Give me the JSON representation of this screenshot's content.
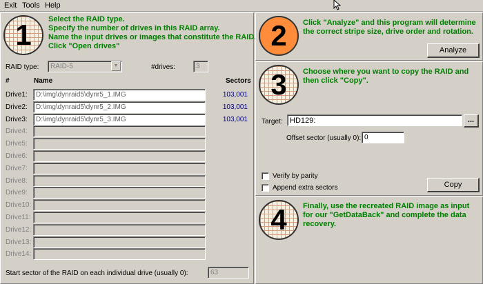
{
  "menu": {
    "exit": "Exit",
    "tools": "Tools",
    "help": "Help"
  },
  "step1": {
    "number": "1",
    "lines": [
      "Select the RAID type.",
      "Specify the number of drives in this RAID array.",
      "Name the input drives or images that constitute the RAID.",
      "Click \"Open drives\""
    ],
    "raid_type_label": "RAID type:",
    "raid_type_value": "RAID-5",
    "drives_label": "#drives:",
    "drives_value": "3",
    "col_num": "#",
    "col_name": "Name",
    "col_sectors": "Sectors",
    "drives": [
      {
        "label": "Drive1:",
        "path": "D:\\img\\dynraid5\\dynr5_1.IMG",
        "sectors": "103,001"
      },
      {
        "label": "Drive2:",
        "path": "D:\\img\\dynraid5\\dynr5_2.IMG",
        "sectors": "103,001"
      },
      {
        "label": "Drive3:",
        "path": "D:\\img\\dynraid5\\dynr5_3.IMG",
        "sectors": "103,001"
      },
      {
        "label": "Drive4:",
        "path": "",
        "sectors": ""
      },
      {
        "label": "Drive5:",
        "path": "",
        "sectors": ""
      },
      {
        "label": "Drive6:",
        "path": "",
        "sectors": ""
      },
      {
        "label": "Drive7:",
        "path": "",
        "sectors": ""
      },
      {
        "label": "Drive8:",
        "path": "",
        "sectors": ""
      },
      {
        "label": "Drive9:",
        "path": "",
        "sectors": ""
      },
      {
        "label": "Drive10:",
        "path": "",
        "sectors": ""
      },
      {
        "label": "Drive11:",
        "path": "",
        "sectors": ""
      },
      {
        "label": "Drive12:",
        "path": "",
        "sectors": ""
      },
      {
        "label": "Drive13:",
        "path": "",
        "sectors": ""
      },
      {
        "label": "Drive14:",
        "path": "",
        "sectors": ""
      }
    ],
    "start_sector_label": "Start sector of the RAID on each individual drive (usually 0):",
    "start_sector_value": "63"
  },
  "step2": {
    "number": "2",
    "lines": [
      "Click \"Analyze\" and this program will determine",
      "the correct stripe size, drive order and rotation."
    ],
    "analyze_label": "Analyze"
  },
  "step3": {
    "number": "3",
    "lines": [
      "Choose where you want to copy the RAID and",
      "then click \"Copy\"."
    ],
    "target_label": "Target:",
    "target_value": "HD129:",
    "browse_label": "...",
    "offset_label": "Offset sector (usually 0):",
    "offset_value": "0",
    "verify_label": "Verify by parity",
    "append_label": "Append extra sectors",
    "copy_label": "Copy"
  },
  "step4": {
    "number": "4",
    "lines": [
      "Finally, use the recreated RAID image as input",
      "for our \"GetDataBack\" and complete the data",
      "recovery."
    ]
  },
  "colors": {
    "accent_green": "#008000",
    "step2_orange": "#ff8c3a",
    "sectors_blue": "#000080"
  }
}
